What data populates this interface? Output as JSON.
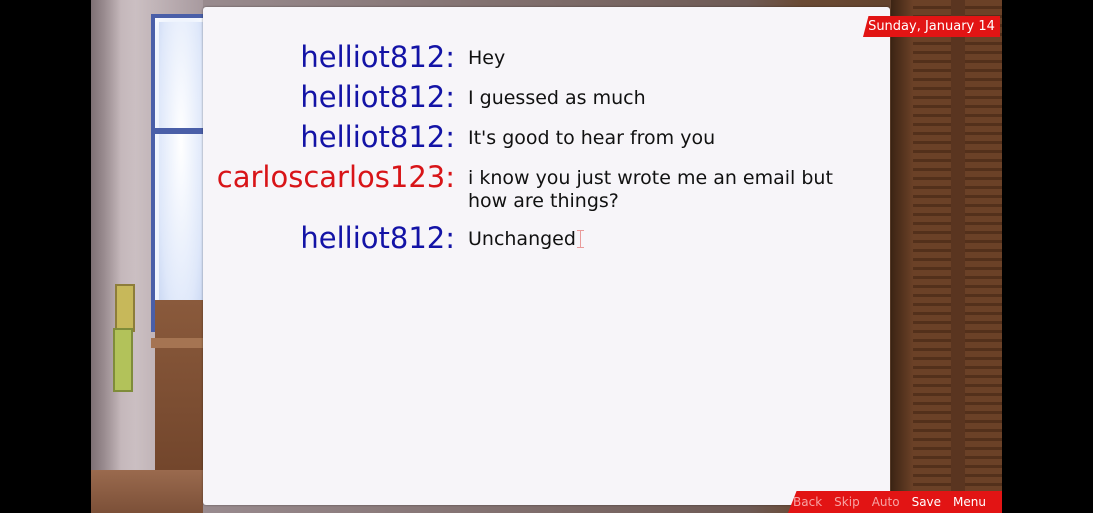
{
  "date": "Sunday, January 14",
  "messages": [
    {
      "sender": "helliot812:",
      "text": "Hey",
      "color": "#1313a6"
    },
    {
      "sender": "helliot812:",
      "text": "I guessed as much",
      "color": "#1313a6"
    },
    {
      "sender": "helliot812:",
      "text": "It's good to hear from you",
      "color": "#1313a6"
    },
    {
      "sender": "carloscarlos123:",
      "text": "i know you just wrote me an email but how are things?",
      "color": "#d81418"
    },
    {
      "sender": "helliot812:",
      "text": "Unchanged",
      "color": "#1313a6"
    }
  ],
  "quick_menu": {
    "back": "Back",
    "skip": "Skip",
    "auto": "Auto",
    "save": "Save",
    "menu": "Menu"
  },
  "colors": {
    "accent": "#e21414",
    "panel": "#f7f5f9"
  },
  "icons": [
    "text-cursor-icon"
  ]
}
